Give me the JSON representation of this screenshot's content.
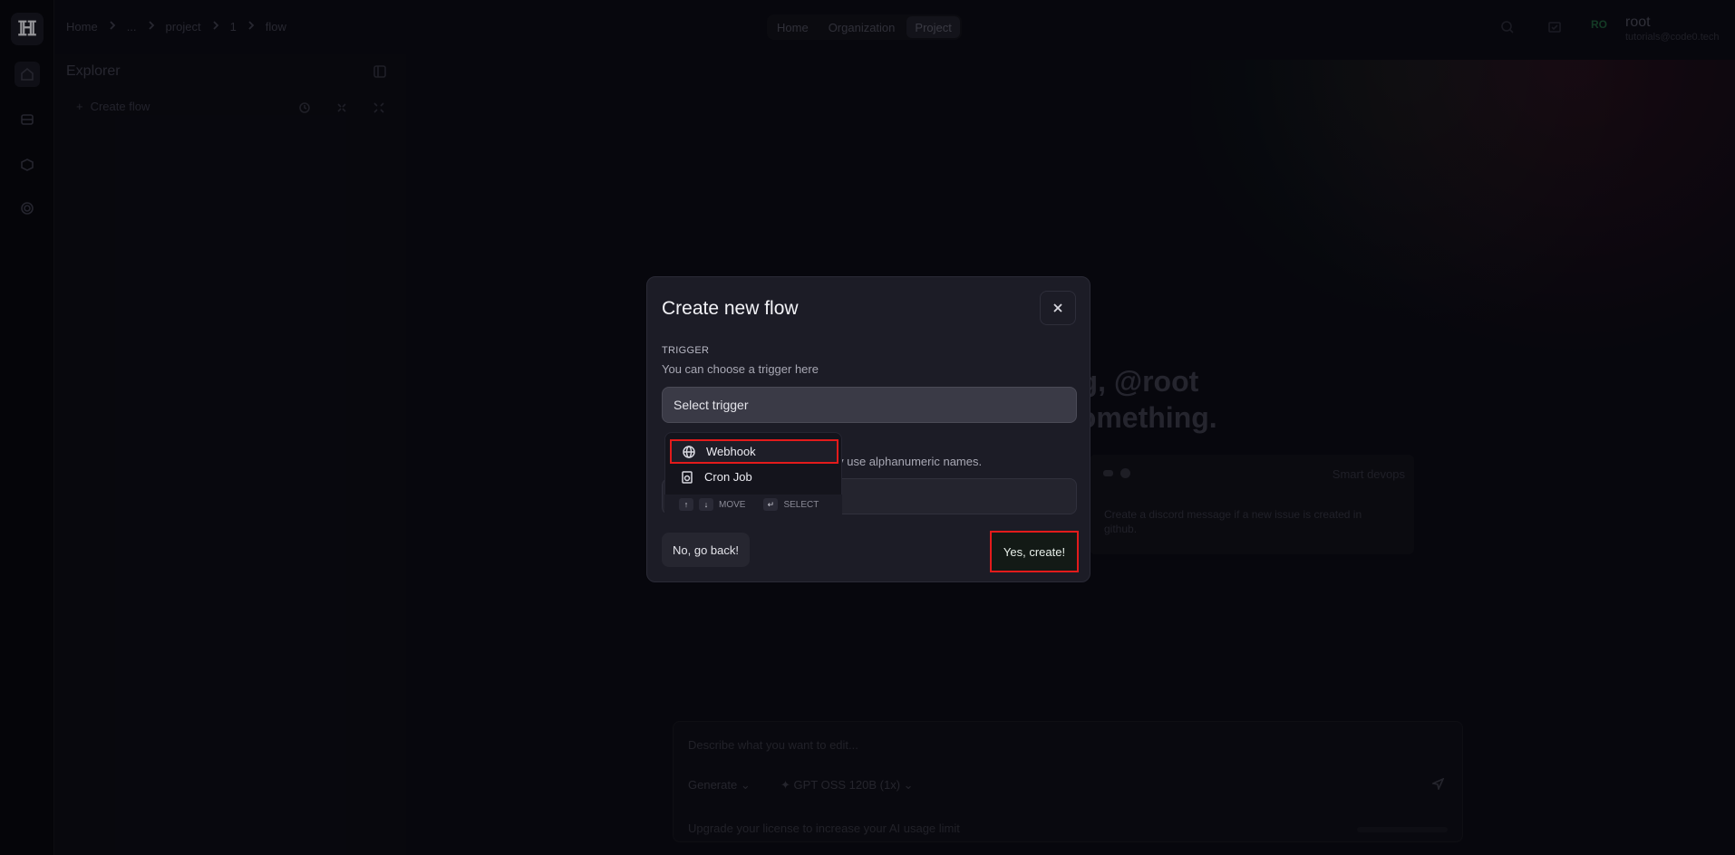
{
  "breadcrumb": [
    "Home",
    "...",
    "project",
    "1",
    "flow"
  ],
  "nav": {
    "items": [
      "Home",
      "Organization",
      "Project"
    ],
    "active": "Project"
  },
  "user": {
    "initials": "RO",
    "name": "root",
    "email": "tutorials@code0.tech"
  },
  "explorer": {
    "title": "Explorer",
    "create_flow": "Create flow"
  },
  "main": {
    "greeting_line1": "ng, @root",
    "greeting_line2": "something.",
    "suggestion": {
      "tag": "Smart devops",
      "text": "Create a discord message if a new issue is created in github."
    },
    "prompt": {
      "placeholder": "Describe what you want to edit...",
      "mode": "Generate",
      "model": "GPT OSS 120B",
      "model_multiplier": "(1x)",
      "footer": "Upgrade your license to increase your AI usage limit"
    }
  },
  "modal": {
    "title": "Create new flow",
    "trigger_label": "TRIGGER",
    "trigger_hint": "You can choose a trigger here",
    "trigger_placeholder": "Select trigger",
    "name_hint": "nly use alphanumeric names.",
    "back_label": "No, go back!",
    "create_label": "Yes, create!"
  },
  "dropdown": {
    "items": [
      {
        "label": "Webhook",
        "icon": "globe-icon"
      },
      {
        "label": "Cron Job",
        "icon": "clock-file-icon"
      }
    ],
    "footer_move": "MOVE",
    "footer_select": "SELECT"
  }
}
